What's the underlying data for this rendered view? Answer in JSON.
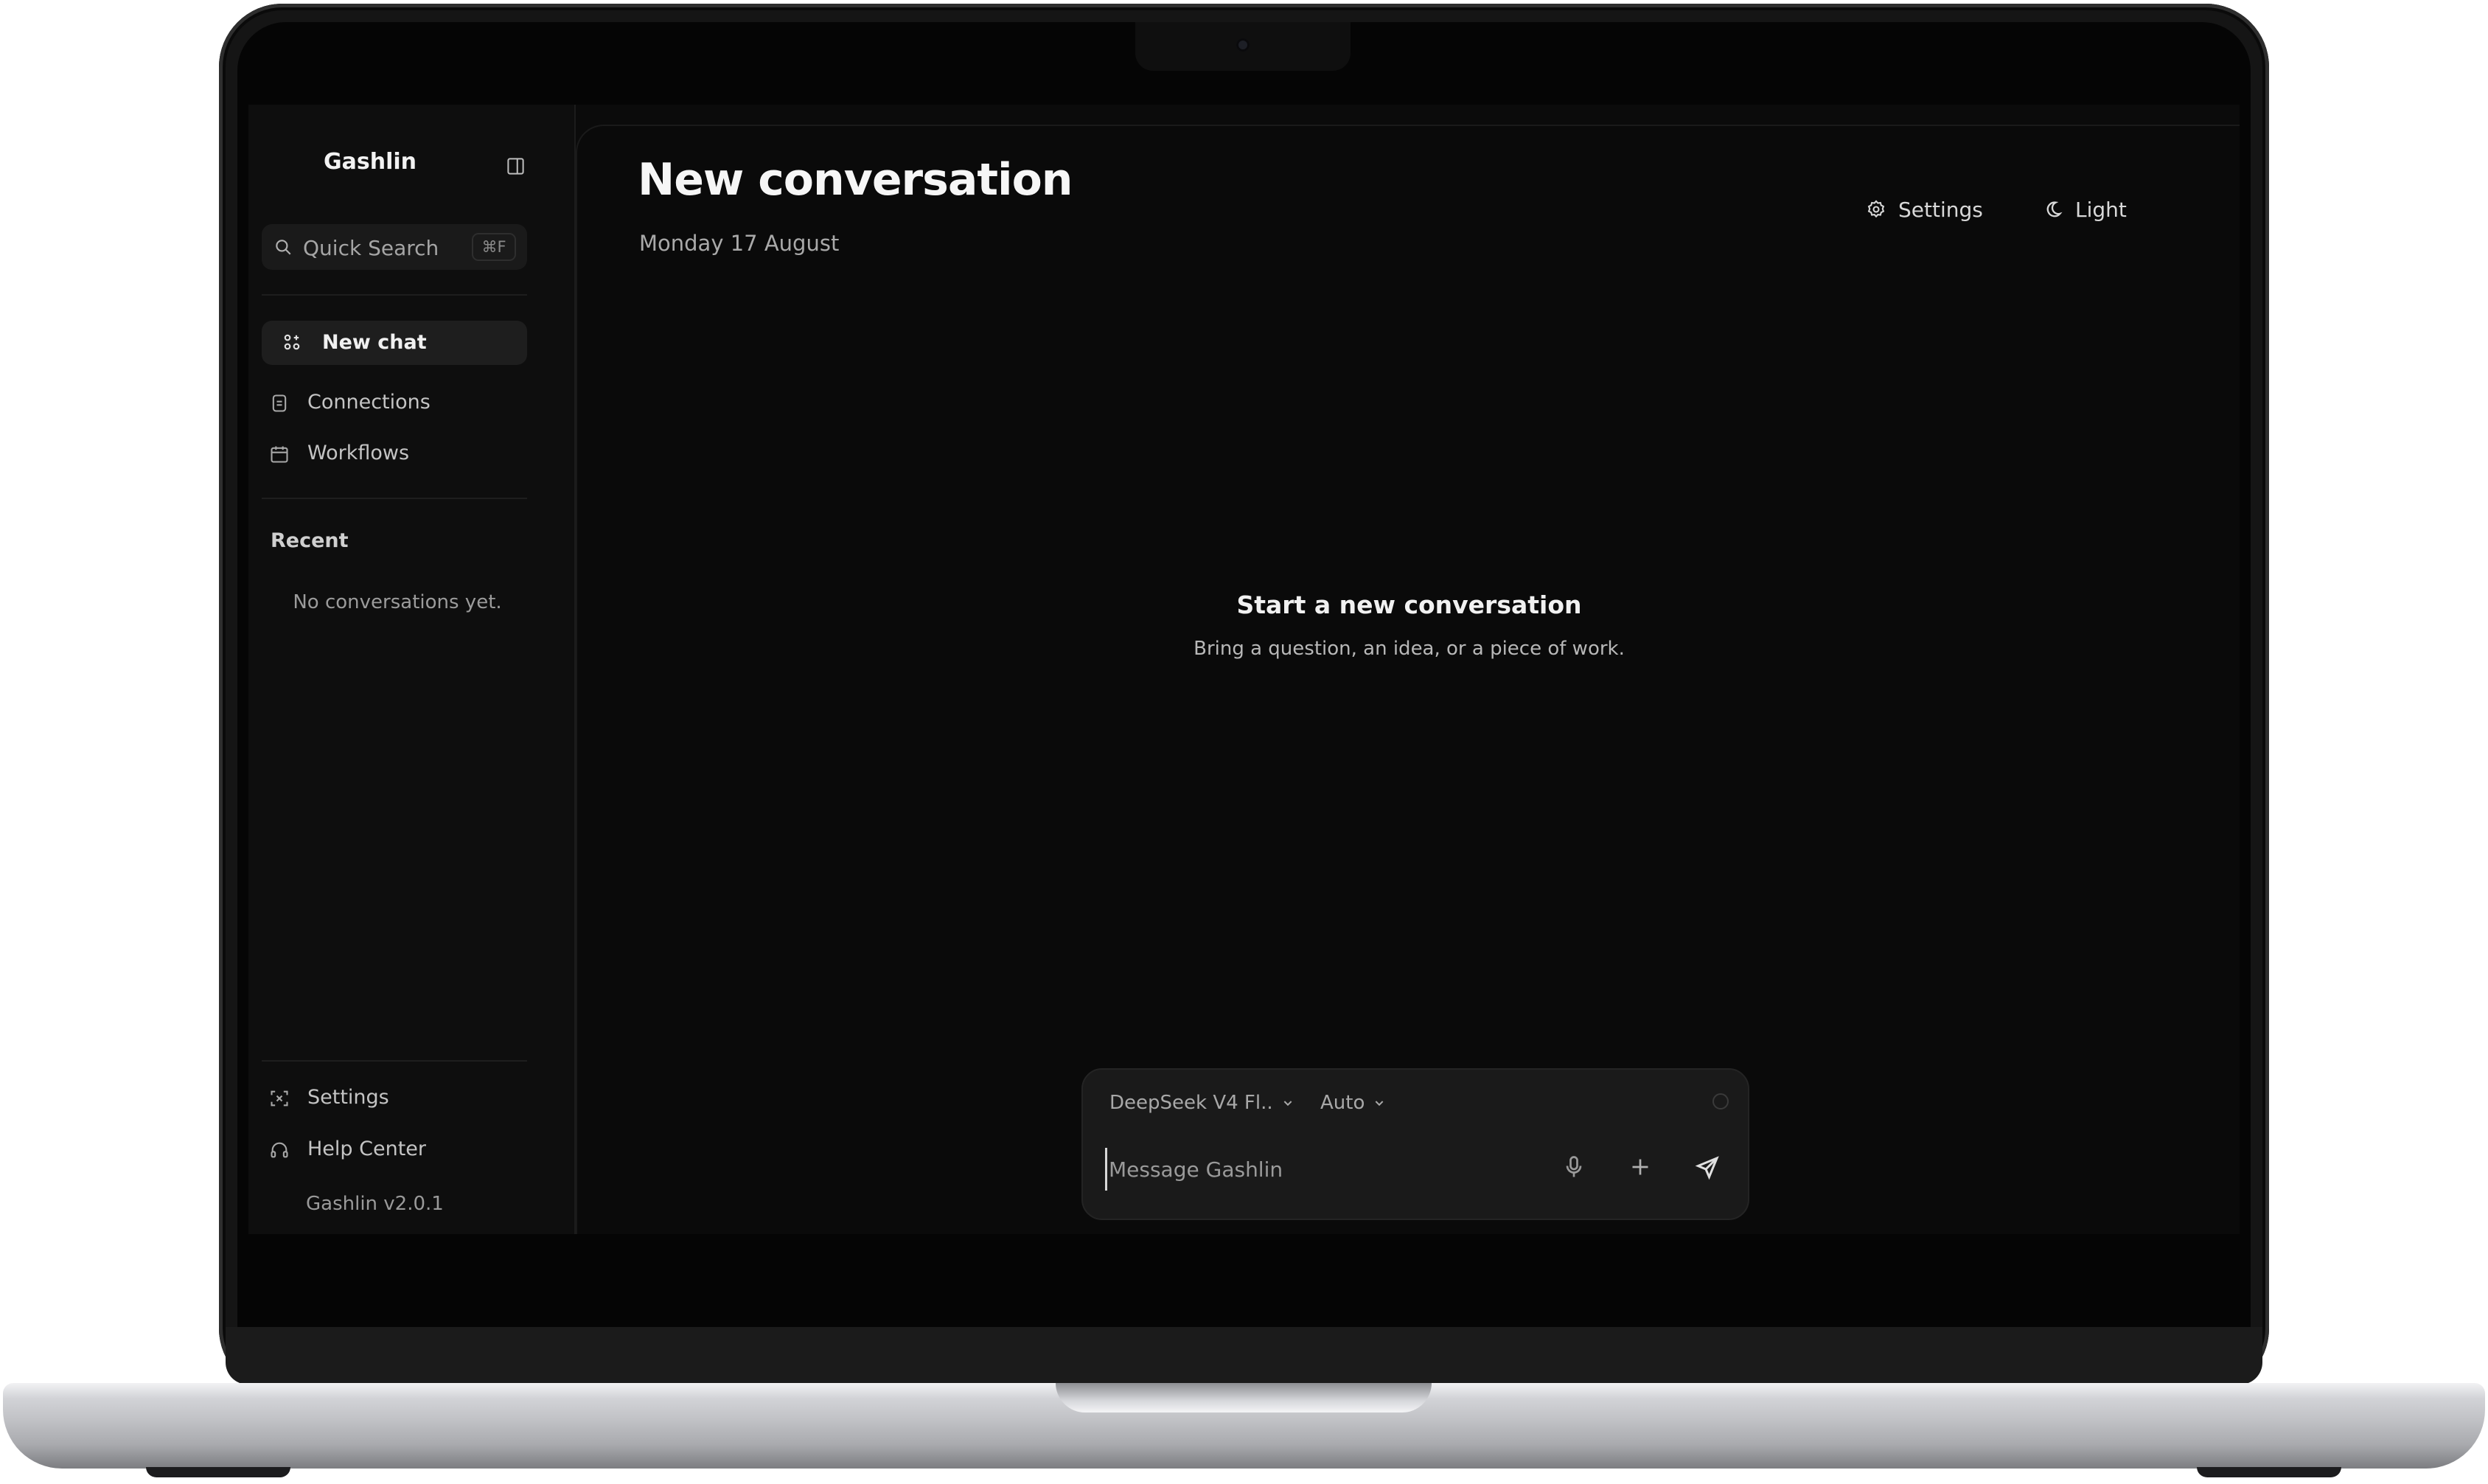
{
  "app": {
    "name": "Gashlin",
    "version": "Gashlin v2.0.1"
  },
  "sidebar": {
    "search": {
      "placeholder": "Quick Search",
      "shortcut": "⌘F"
    },
    "new_chat_label": "New chat",
    "nav": [
      {
        "label": "Connections",
        "icon": "connections-icon"
      },
      {
        "label": "Workflows",
        "icon": "calendar-icon"
      }
    ],
    "recent": {
      "title": "Recent",
      "empty_text": "No conversations yet."
    },
    "footer": [
      {
        "label": "Settings",
        "icon": "settings-icon"
      },
      {
        "label": "Help Center",
        "icon": "headset-icon"
      }
    ]
  },
  "header": {
    "title": "New conversation",
    "date": "Monday 17 August",
    "settings_label": "Settings",
    "theme_label": "Light"
  },
  "empty_state": {
    "title": "Start a new conversation",
    "subtitle": "Bring a question, an idea, or a piece of work."
  },
  "composer": {
    "model_label": "DeepSeek V4 Fl..",
    "mode_label": "Auto",
    "placeholder": "Message Gashlin"
  },
  "colors": {
    "background": "#0a0a0a",
    "sidebar": "#0e0e0e",
    "surface": "#1a1a1a",
    "text_primary": "#f2f2f2",
    "text_muted": "#a9a9a9"
  }
}
